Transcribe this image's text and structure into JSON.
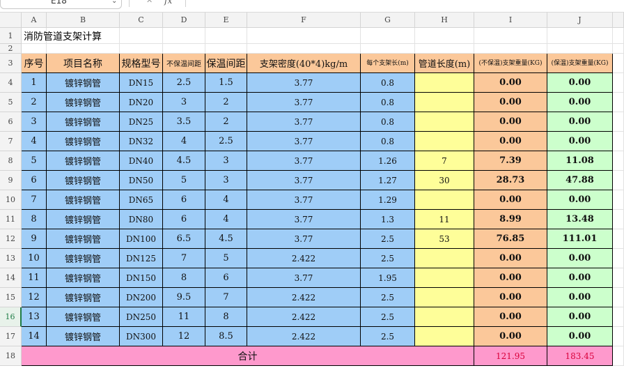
{
  "formula_bar": {
    "name_box": "E18",
    "cancel_icon": "✕",
    "fx_label": "fx"
  },
  "columns": [
    "A",
    "B",
    "C",
    "D",
    "E",
    "F",
    "G",
    "H",
    "I",
    "J"
  ],
  "rows": [
    "1",
    "2",
    "3",
    "4",
    "5",
    "6",
    "7",
    "8",
    "9",
    "10",
    "11",
    "12",
    "13",
    "14",
    "15",
    "16",
    "17",
    "18"
  ],
  "active_row": "16",
  "sheet": {
    "title": "消防管道支架计算",
    "headers": {
      "seq": "序号",
      "name": "项目名称",
      "spec": "规格型号",
      "spacing_noins": "不保温间距",
      "spacing_ins": "保温间距",
      "density": "支架密度(40*4)kg/m",
      "support_len": "每个支架长(m)",
      "pipe_len": "管道长度(m)",
      "weight_noins": "(不保温)支架重量(KG)",
      "weight_ins": "(保温)支架重量(KG)"
    },
    "data_rows": [
      {
        "seq": "1",
        "name": "镀锌钢管",
        "spec": "DN15",
        "d": "2.5",
        "e": "1.5",
        "f": "3.77",
        "g": "0.8",
        "h": "",
        "i": "0.00",
        "j": "0.00"
      },
      {
        "seq": "2",
        "name": "镀锌钢管",
        "spec": "DN20",
        "d": "3",
        "e": "2",
        "f": "3.77",
        "g": "0.8",
        "h": "",
        "i": "0.00",
        "j": "0.00"
      },
      {
        "seq": "3",
        "name": "镀锌钢管",
        "spec": "DN25",
        "d": "3.5",
        "e": "2",
        "f": "3.77",
        "g": "0.8",
        "h": "",
        "i": "0.00",
        "j": "0.00"
      },
      {
        "seq": "4",
        "name": "镀锌钢管",
        "spec": "DN32",
        "d": "4",
        "e": "2.5",
        "f": "3.77",
        "g": "0.8",
        "h": "",
        "i": "0.00",
        "j": "0.00"
      },
      {
        "seq": "5",
        "name": "镀锌钢管",
        "spec": "DN40",
        "d": "4.5",
        "e": "3",
        "f": "3.77",
        "g": "1.26",
        "h": "7",
        "i": "7.39",
        "j": "11.08"
      },
      {
        "seq": "6",
        "name": "镀锌钢管",
        "spec": "DN50",
        "d": "5",
        "e": "3",
        "f": "3.77",
        "g": "1.27",
        "h": "30",
        "i": "28.73",
        "j": "47.88"
      },
      {
        "seq": "7",
        "name": "镀锌钢管",
        "spec": "DN65",
        "d": "6",
        "e": "4",
        "f": "3.77",
        "g": "1.29",
        "h": "",
        "i": "0.00",
        "j": "0.00"
      },
      {
        "seq": "8",
        "name": "镀锌钢管",
        "spec": "DN80",
        "d": "6",
        "e": "4",
        "f": "3.77",
        "g": "1.3",
        "h": "11",
        "i": "8.99",
        "j": "13.48"
      },
      {
        "seq": "9",
        "name": "镀锌钢管",
        "spec": "DN100",
        "d": "6.5",
        "e": "4.5",
        "f": "3.77",
        "g": "2.5",
        "h": "53",
        "i": "76.85",
        "j": "111.01"
      },
      {
        "seq": "10",
        "name": "镀锌钢管",
        "spec": "DN125",
        "d": "7",
        "e": "5",
        "f": "2.422",
        "g": "2.5",
        "h": "",
        "i": "0.00",
        "j": "0.00"
      },
      {
        "seq": "11",
        "name": "镀锌钢管",
        "spec": "DN150",
        "d": "8",
        "e": "6",
        "f": "3.77",
        "g": "1.95",
        "h": "",
        "i": "0.00",
        "j": "0.00"
      },
      {
        "seq": "12",
        "name": "镀锌钢管",
        "spec": "DN200",
        "d": "9.5",
        "e": "7",
        "f": "2.422",
        "g": "2.5",
        "h": "",
        "i": "0.00",
        "j": "0.00"
      },
      {
        "seq": "13",
        "name": "镀锌钢管",
        "spec": "DN250",
        "d": "11",
        "e": "8",
        "f": "2.422",
        "g": "2.5",
        "h": "",
        "i": "0.00",
        "j": "0.00"
      },
      {
        "seq": "14",
        "name": "镀锌钢管",
        "spec": "DN300",
        "d": "12",
        "e": "8.5",
        "f": "2.422",
        "g": "2.5",
        "h": "",
        "i": "0.00",
        "j": "0.00"
      }
    ],
    "total": {
      "label": "合计",
      "i": "121.95",
      "j": "183.45"
    }
  },
  "colors": {
    "header_bg": "#fbc89a",
    "blue_bg": "#9fcdf7",
    "input_bg": "#fefe99",
    "ins_bg": "#ccffcc",
    "total_bg": "#fe99cc",
    "total_text": "#d9003a",
    "active_row": "#1e7b45"
  }
}
